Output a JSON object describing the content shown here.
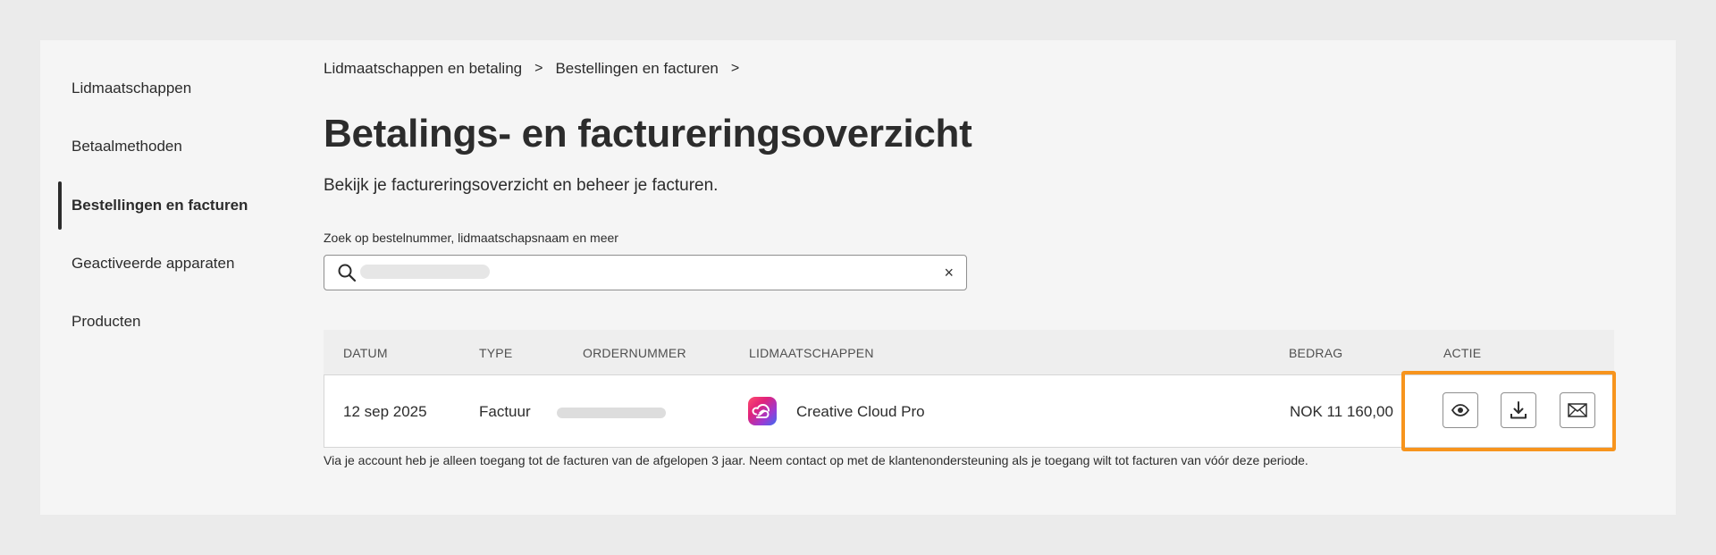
{
  "sidebar": {
    "items": [
      {
        "label": "Lidmaatschappen"
      },
      {
        "label": "Betaalmethoden"
      },
      {
        "label": "Bestellingen en facturen",
        "active": true
      },
      {
        "label": "Geactiveerde apparaten"
      },
      {
        "label": "Producten"
      }
    ]
  },
  "breadcrumb": {
    "items": [
      "Lidmaatschappen en betaling",
      "Bestellingen en facturen"
    ],
    "separator": ">"
  },
  "page": {
    "title": "Betalings- en factureringsoverzicht",
    "subtitle": "Bekijk je factureringsoverzicht en beheer je facturen."
  },
  "search": {
    "label": "Zoek op bestelnummer, lidmaatschapsnaam en meer",
    "value": "",
    "clear_symbol": "×"
  },
  "table": {
    "headers": {
      "date": "DATUM",
      "type": "TYPE",
      "order": "ORDERNUMMER",
      "memberships": "LIDMAATSCHAPPEN",
      "amount": "BEDRAG",
      "action": "ACTIE"
    },
    "rows": [
      {
        "date": "12 sep 2025",
        "type": "Factuur",
        "order": "",
        "membership": "Creative Cloud Pro",
        "amount": "NOK 11 160,00",
        "actions": [
          "eye-icon",
          "download-icon",
          "mail-icon"
        ]
      }
    ]
  },
  "footnote": "Via je account heb je alleen toegang tot de facturen van de afgelopen 3 jaar. Neem contact op met de klantenondersteuning als je toegang wilt tot facturen van vóór deze periode.",
  "colors": {
    "highlight": "#f7941d",
    "background": "#ebebeb",
    "card": "#f5f5f5"
  }
}
